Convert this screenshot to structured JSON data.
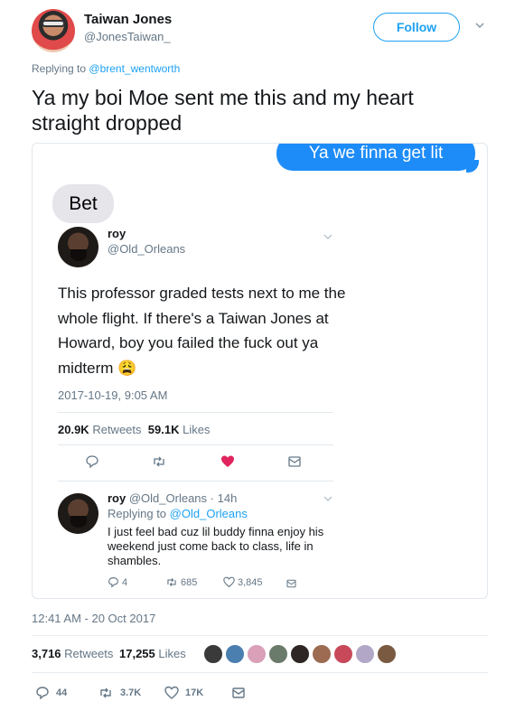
{
  "author": {
    "name": "Taiwan Jones",
    "handle": "@JonesTaiwan_",
    "follow_label": "Follow"
  },
  "replying": {
    "prefix": "Replying to",
    "handle": "@brent_wentworth"
  },
  "tweet": {
    "text": "Ya my boi Moe sent me this and my heart straight dropped"
  },
  "media": {
    "imessage_sent": "Ya we finna get lit",
    "imessage_received": "Bet",
    "quoted_tweet": {
      "name": "roy",
      "handle": "@Old_Orleans",
      "text": "This professor graded tests next to me the whole flight. If there's a Taiwan Jones at Howard, boy you failed the fuck out ya midterm",
      "emoji": "😩",
      "timestamp": "2017-10-19, 9:05 AM",
      "retweets_count": "20.9K",
      "retweets_label": "Retweets",
      "likes_count": "59.1K",
      "likes_label": "Likes"
    },
    "reply": {
      "name": "roy",
      "handle": "@Old_Orleans",
      "time": "· 14h",
      "replying_prefix": "Replying to",
      "replying_handle": "@Old_Orleans",
      "text": "I just feel bad cuz lil buddy finna enjoy his weekend just come back to class, life in shambles.",
      "replies": "4",
      "retweets": "685",
      "likes": "3,845"
    }
  },
  "footer": {
    "timestamp": "12:41 AM - 20 Oct 2017",
    "retweets_count": "3,716",
    "retweets_label": "Retweets",
    "likes_count": "17,255",
    "likes_label": "Likes",
    "reply_count": "44",
    "retweet_count": "3.7K",
    "like_count": "17K"
  },
  "colors": {
    "accent": "#1da1f2",
    "imessage_blue": "#1d8cf8",
    "heart_red": "#e0245e",
    "muted": "#657786"
  },
  "likers": [
    "avatar-1",
    "avatar-2",
    "avatar-3",
    "avatar-4",
    "avatar-5",
    "avatar-6",
    "avatar-7",
    "avatar-8",
    "avatar-9"
  ]
}
